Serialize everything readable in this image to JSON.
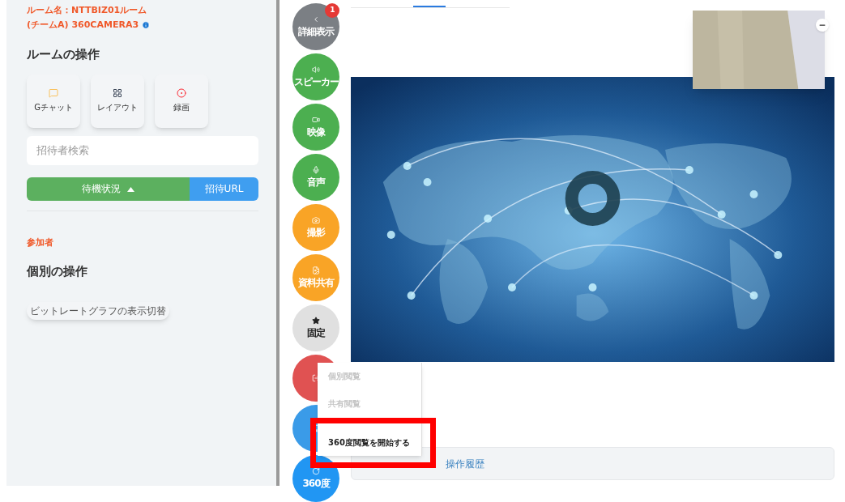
{
  "room": {
    "name_line1": "ルーム名：NTTBIZ01ルーム",
    "name_line2": "(チームA) 360CAMERA3"
  },
  "room_ops": {
    "title": "ルームの操作",
    "buttons": [
      {
        "label": "Gチャット",
        "kind": "chat"
      },
      {
        "label": "レイアウト",
        "kind": "layout"
      },
      {
        "label": "録画",
        "kind": "record"
      }
    ]
  },
  "invite_search": {
    "placeholder": "招待者検索"
  },
  "status_button": {
    "label": "待機状況",
    "expanded": true
  },
  "invite_url_button": {
    "label": "招待URL"
  },
  "participants_label": "参加者",
  "individual_ops": {
    "title": "個別の操作",
    "buttons": [
      "ビットレートグラフの表示切替"
    ]
  },
  "side_buttons": [
    {
      "label": "詳細表示",
      "kind": "details",
      "color": "#7b7f84",
      "badge": "1"
    },
    {
      "label": "スピーカー",
      "kind": "speaker",
      "color": "#4caf50"
    },
    {
      "label": "映像",
      "kind": "video",
      "color": "#4caf50"
    },
    {
      "label": "音声",
      "kind": "mic",
      "color": "#4caf50"
    },
    {
      "label": "撮影",
      "kind": "camera",
      "color": "#f9a426"
    },
    {
      "label": "資料共有",
      "kind": "share",
      "color": "#f9a426"
    },
    {
      "label": "固定",
      "kind": "pin",
      "color": "#e0e0e0"
    },
    {
      "kind": "exit",
      "color": "#e05252"
    },
    {
      "kind": "screen",
      "color": "#3a9be8"
    },
    {
      "label": "360度",
      "kind": "panorama",
      "color": "#2196f3"
    }
  ],
  "bottom_tabs": [
    {
      "label": "操作履歴",
      "selected": false
    }
  ],
  "menu": {
    "items": [
      {
        "label": "個別閲覧",
        "disabled": true
      },
      {
        "label": "共有閲覧",
        "disabled": true
      },
      {
        "label": "360度閲覧を開始する",
        "disabled": false,
        "highlighted": true
      }
    ]
  }
}
